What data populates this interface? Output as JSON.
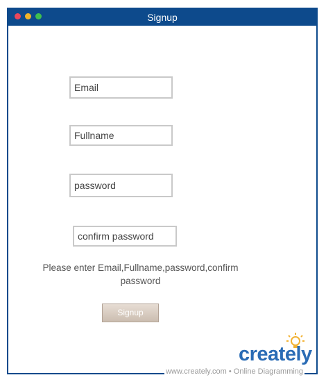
{
  "window": {
    "title": "Signup"
  },
  "form": {
    "email_placeholder": "Email",
    "fullname_placeholder": "Fullname",
    "password_placeholder": "password",
    "confirm_placeholder": "confirm password",
    "hint_text": "Please enter  Email,Fullname,password,confirm password",
    "submit_label": "Signup"
  },
  "watermark": {
    "text": "www.creately.com • Online Diagramming",
    "logo": "creately"
  },
  "colors": {
    "titlebar": "#0d4a8c",
    "border": "#0d4a8c",
    "button": "#d8ccc1",
    "logo": "#2a6cb5",
    "bulb": "#f2b233"
  },
  "icons": [
    "close-dot-icon",
    "minimize-dot-icon",
    "maximize-dot-icon",
    "lightbulb-icon"
  ]
}
